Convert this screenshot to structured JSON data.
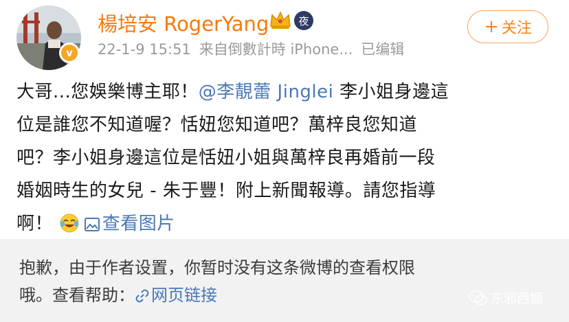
{
  "header": {
    "username": "楊培安 RogerYang",
    "night_badge": "夜",
    "verified_mark": "v",
    "timestamp": "22-1-9 15:51",
    "source": "来自倒數計時 iPhone...",
    "edited": "已编辑",
    "follow_label": "关注",
    "follow_plus": "+"
  },
  "post": {
    "line1_before": "大哥...您娛樂博主耶！",
    "mention": "@李靚蕾 Jinglei",
    "line1_after": " 李小姐身邊這",
    "line2": "位是誰您不知道喔？恬妞您知道吧？萬梓良您知道",
    "line3": "吧？李小姐身邊這位是恬妞小姐與萬梓良再婚前一段",
    "line4": "婚姻時生的女兒 - 朱于豐！附上新聞報導。請您指導",
    "line5": "啊！",
    "view_pictures": "查看图片"
  },
  "notice": {
    "line1": "抱歉，由于作者设置，你暂时没有这条微博的查看权限",
    "line2_prefix": "哦。查看帮助：",
    "help_link": "网页链接"
  },
  "watermark": "东邪西媚",
  "colors": {
    "username": "#f77a0c",
    "link": "#4a78b5",
    "follow_border": "#f7a35c",
    "notice_bg": "#f2f2f2"
  }
}
